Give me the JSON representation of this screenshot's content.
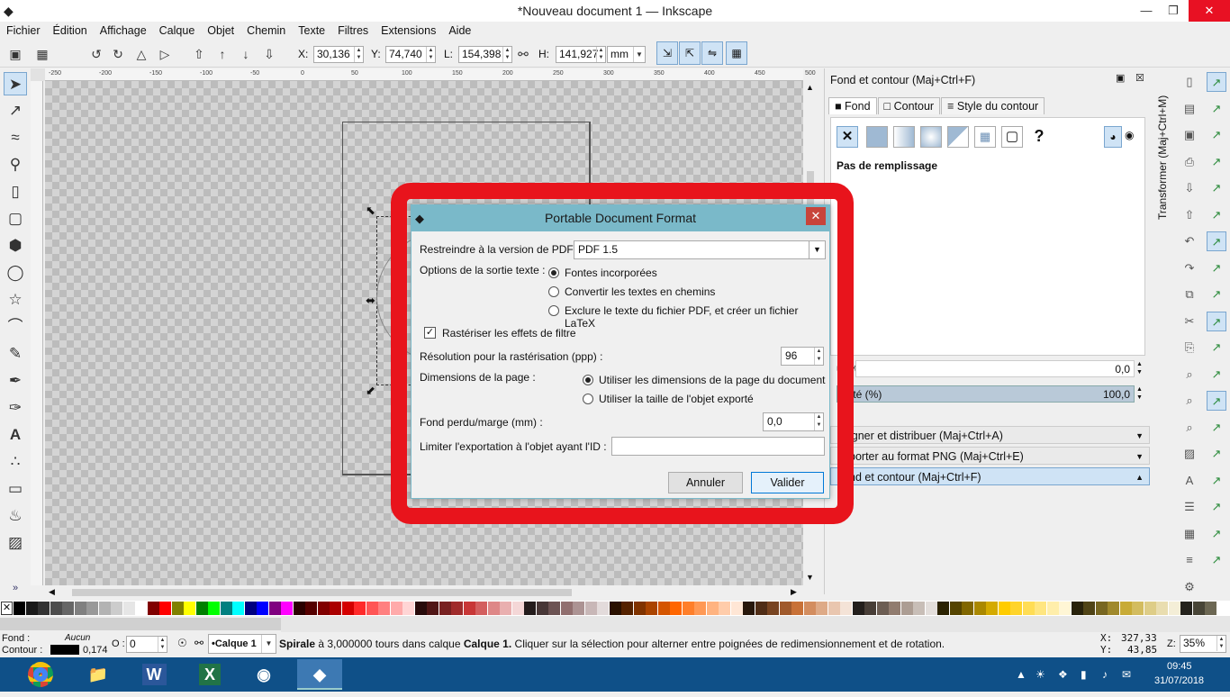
{
  "window": {
    "title": "*Nouveau document 1 — Inkscape",
    "minimize": "—",
    "maximize": "❐",
    "close": "✕"
  },
  "menu": [
    "Fichier",
    "Édition",
    "Affichage",
    "Calque",
    "Objet",
    "Chemin",
    "Texte",
    "Filtres",
    "Extensions",
    "Aide"
  ],
  "toolbar": {
    "x_label": "X:",
    "x_value": "30,136",
    "y_label": "Y:",
    "y_value": "74,740",
    "w_label": "L:",
    "w_value": "154,398",
    "h_label": "H:",
    "h_value": "141,927",
    "unit": "mm"
  },
  "ruler_ticks": [
    "-250",
    "-200",
    "-150",
    "-100",
    "-50",
    "0",
    "50",
    "100",
    "150",
    "200",
    "250",
    "300",
    "350",
    "400",
    "450",
    "500"
  ],
  "panel": {
    "title": "Fond et contour (Maj+Ctrl+F)",
    "tabs": [
      "Fond",
      "Contour",
      "Style du contour"
    ],
    "fill_status": "Pas de remplissage",
    "blur_label": "u (%)",
    "blur_value": "0,0",
    "opacity_label": "acité (%)",
    "opacity_value": "100,0",
    "collapsed": [
      "igner et distribuer (Maj+Ctrl+A)",
      "porter au format PNG (Maj+Ctrl+E)",
      "nd et contour (Maj+Ctrl+F)"
    ],
    "side_tab": "Transformer (Maj+Ctrl+M)"
  },
  "dialog": {
    "title": "Portable Document Format",
    "pdf_version_label": "Restreindre à la version de PDF :",
    "pdf_version_value": "PDF 1.5",
    "text_output_label": "Options de la sortie texte :",
    "text_options": [
      "Fontes incorporées",
      "Convertir les textes en chemins",
      "Exclure le texte du fichier PDF, et créer un fichier LaTeX"
    ],
    "rasterize_label": "Rastériser les effets de filtre",
    "resolution_label": "Résolution pour la rastérisation (ppp) :",
    "resolution_value": "96",
    "page_dims_label": "Dimensions de la page :",
    "page_dims_options": [
      "Utiliser les dimensions de la page du document",
      "Utiliser la taille de l'objet exporté"
    ],
    "bleed_label": "Fond perdu/marge (mm) :",
    "bleed_value": "0,0",
    "limit_label": "Limiter l'exportation à l'objet ayant l'ID :",
    "limit_value": "",
    "cancel": "Annuler",
    "ok": "Valider"
  },
  "status": {
    "fill_label": "Fond :",
    "fill_value": "Aucun",
    "stroke_label": "Contour :",
    "stroke_width": "0,174",
    "opacity_label": "O :",
    "opacity_value": "0",
    "layer": "•Calque 1",
    "message_bold": "Spirale",
    "message": " à 3,000000 tours dans calque ",
    "message_layer": "Calque 1.",
    "message_rest": " Cliquer sur la sélection pour alterner entre poignées de redimensionnement et de rotation.",
    "x_label": "X:",
    "x_value": "327,33",
    "y_label": "Y:",
    "y_value": "43,85",
    "zoom_label": "Z:",
    "zoom_value": "35%"
  },
  "taskbar": {
    "time": "09:45",
    "date": "31/07/2018"
  },
  "palette": [
    "#000000",
    "#1a1a1a",
    "#333333",
    "#4d4d4d",
    "#666666",
    "#808080",
    "#999999",
    "#b3b3b3",
    "#cccccc",
    "#e6e6e6",
    "#ffffff",
    "#800000",
    "#ff0000",
    "#808000",
    "#ffff00",
    "#008000",
    "#00ff00",
    "#008080",
    "#00ffff",
    "#000080",
    "#0000ff",
    "#800080",
    "#ff00ff",
    "#2b0000",
    "#550000",
    "#800000",
    "#aa0000",
    "#d40000",
    "#ff2a2a",
    "#ff5555",
    "#ff8080",
    "#ffaaaa",
    "#ffd5d5",
    "#280b0b",
    "#501616",
    "#782121",
    "#a02c2c",
    "#c83737",
    "#d35f5f",
    "#de8787",
    "#e9afaf",
    "#f4d7d7",
    "#241c1c",
    "#483737",
    "#6c5353",
    "#916f6f",
    "#ac9393",
    "#c8b7b7",
    "#e3dbdb",
    "#2b1100",
    "#552200",
    "#803300",
    "#aa4400",
    "#d45500",
    "#ff6600",
    "#ff7f2a",
    "#ff9955",
    "#ffb380",
    "#ffccaa",
    "#ffe6d5",
    "#28170b",
    "#502d16",
    "#784421",
    "#a05a2c",
    "#c87137",
    "#d38d5f",
    "#deaa87",
    "#e9c6af",
    "#f4e3d7",
    "#241f1c",
    "#483e37",
    "#6c5d53",
    "#917c6f",
    "#ac9d93",
    "#c8beb7",
    "#e3dedb",
    "#2b2200",
    "#554400",
    "#806600",
    "#aa8800",
    "#d4aa00",
    "#ffcc00",
    "#ffd42a",
    "#ffdd55",
    "#ffe680",
    "#ffeeaa",
    "#fff6d5",
    "#28220b",
    "#504416",
    "#786721",
    "#a0892c",
    "#c8ab37",
    "#d3bc5f",
    "#decd87",
    "#e9ddaf",
    "#f4eed7",
    "#24221c",
    "#484537",
    "#6c6753"
  ]
}
